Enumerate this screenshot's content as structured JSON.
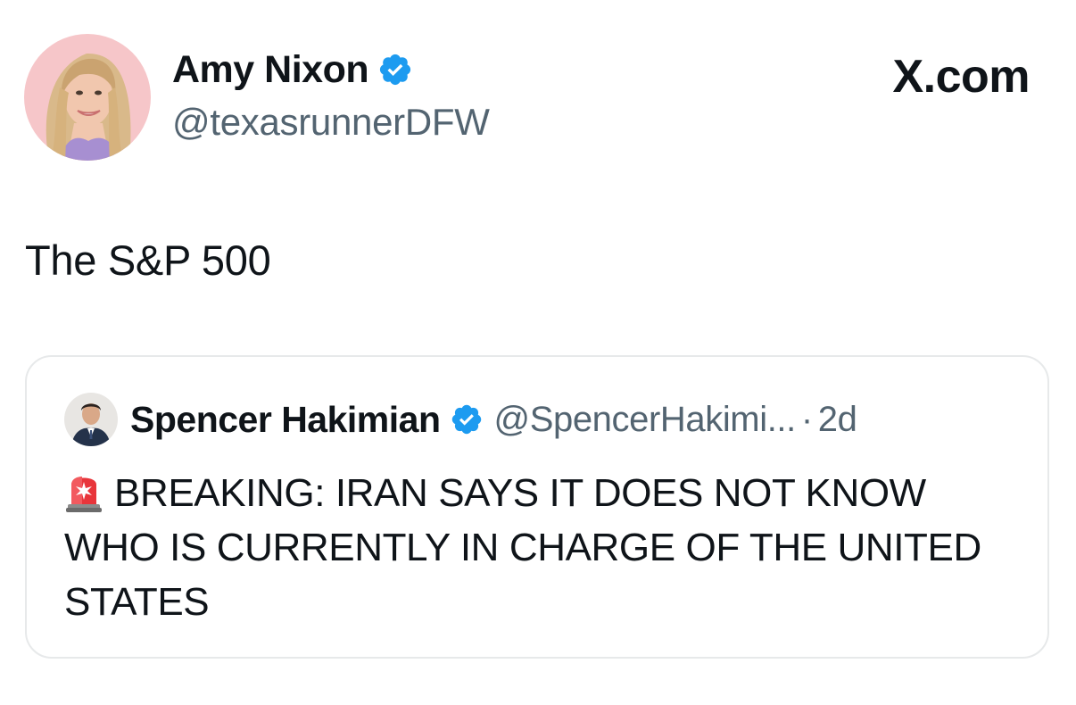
{
  "author": {
    "name": "Amy Nixon",
    "handle": "@texasrunnerDFW",
    "verified": true
  },
  "site": {
    "label": "X.com",
    "icon": "x-logo-icon"
  },
  "tweet": {
    "text": "The S&P 500"
  },
  "quoted_tweet": {
    "author_name": "Spencer Hakimian",
    "handle": "@SpencerHakimi...",
    "separator": "·",
    "time": "2d",
    "verified": true,
    "emoji": "siren-icon",
    "text": "BREAKING: IRAN SAYS IT DOES NOT KNOW WHO IS CURRENTLY IN CHARGE OF THE UNITED STATES"
  },
  "colors": {
    "verified_blue": "#1d9bf0",
    "secondary_text": "#536471",
    "border": "#e7e9ea"
  }
}
